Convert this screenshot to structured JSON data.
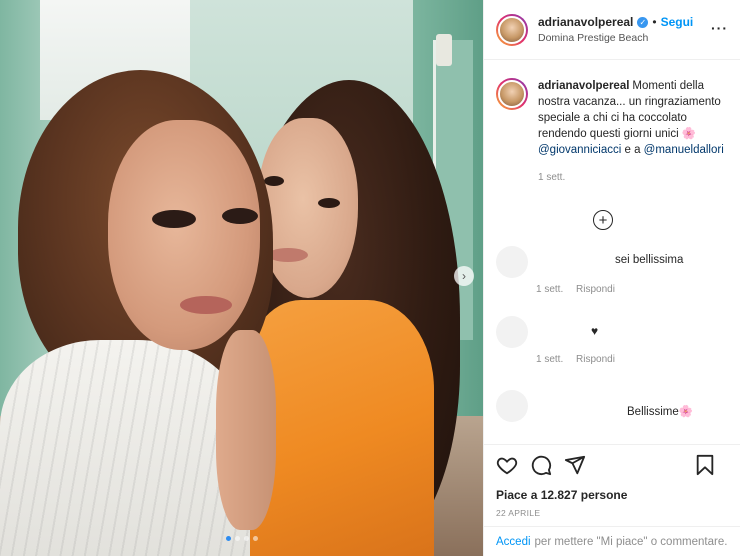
{
  "post": {
    "username": "adrianavolpereal",
    "follow_label": "Segui",
    "separator": "•",
    "location": "Domina Prestige Beach",
    "more_label": "···",
    "carousel": {
      "slides": 4,
      "active": 0
    }
  },
  "caption": {
    "username": "adrianavolpereal",
    "text_before": "Momenti della nostra vacanza... un ringraziamento speciale a chi ci ha coccolato rendendo questi giorni unici 🌸 ",
    "mention1": "@giovanniciacci",
    "text_mid": " e a ",
    "mention2": "@manueldallori",
    "time": "1 sett."
  },
  "comments": [
    {
      "text": "sei bellissima",
      "time": "1 sett.",
      "reply": "Rispondi"
    },
    {
      "text": "♥",
      "time": "1 sett.",
      "reply": "Rispondi"
    },
    {
      "text": "Bellissime🌸",
      "time": "",
      "reply": ""
    }
  ],
  "engagement": {
    "likes": "Piace a 12.827 persone",
    "date": "22 APRILE"
  },
  "login": {
    "link": "Accedi",
    "text": "per mettere \"Mi piace\" o commentare."
  },
  "colors": {
    "accent": "#0095f6",
    "verified": "#3897f0",
    "mention": "#00376b"
  }
}
